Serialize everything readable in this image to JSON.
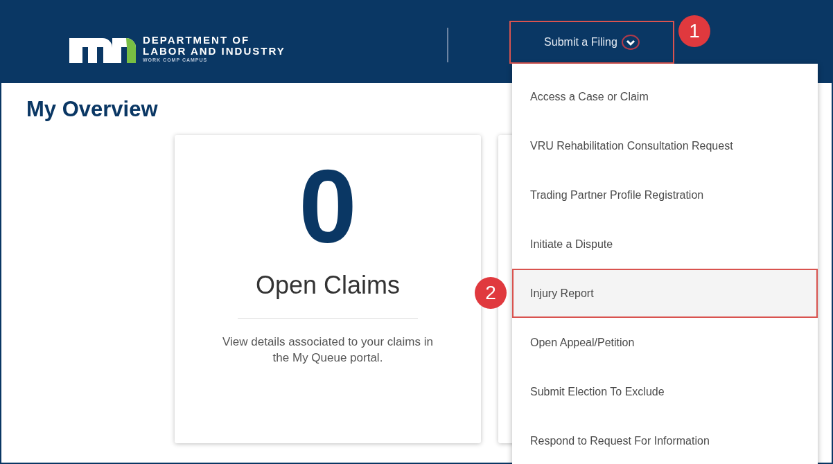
{
  "header": {
    "logo": {
      "line_1": "DEPARTMENT OF",
      "line_2": "LABOR AND INDUSTRY",
      "line_3": "WORK COMP CAMPUS"
    },
    "filing_button": {
      "label": "Submit a Filing",
      "expanded": true,
      "outlined": true,
      "callout": "1"
    }
  },
  "page": {
    "title": "My Overview",
    "cards": [
      {
        "count": "0",
        "label": "Open Claims",
        "description": "View details associated to your claims in the My Queue portal."
      }
    ]
  },
  "dropdown": {
    "items": [
      {
        "label": "Access a Case or Claim",
        "outlined": false
      },
      {
        "label": "VRU Rehabilitation Consultation Request",
        "outlined": false
      },
      {
        "label": "Trading Partner Profile Registration",
        "outlined": false
      },
      {
        "label": "Initiate a Dispute",
        "outlined": false
      },
      {
        "label": "Injury Report",
        "outlined": true,
        "callout": "2"
      },
      {
        "label": "Open Appeal/Petition",
        "outlined": false
      },
      {
        "label": "Submit Election To Exclude",
        "outlined": false
      },
      {
        "label": "Respond to Request For Information",
        "outlined": false
      }
    ]
  }
}
